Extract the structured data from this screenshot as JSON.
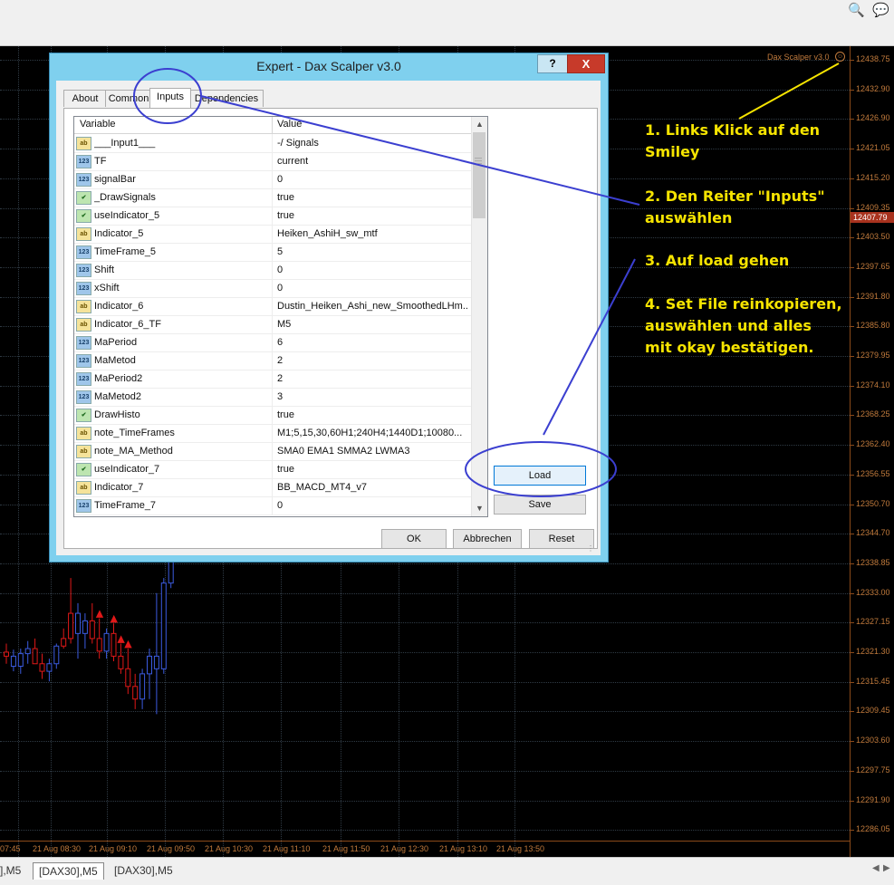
{
  "toolbar": {
    "icons": [
      "search-icon",
      "chat-bubbles-icon"
    ]
  },
  "chart": {
    "indicator_name": "Dax Scalper v3.0",
    "price_labels": [
      "12438.75",
      "12432.90",
      "12426.90",
      "12421.05",
      "12415.20",
      "12409.35",
      "12403.50",
      "12397.65",
      "12391.80",
      "12385.80",
      "12379.95",
      "12374.10",
      "12368.25",
      "12362.40",
      "12356.55",
      "12350.70",
      "12344.70",
      "12338.85",
      "12333.00",
      "12327.15",
      "12321.30",
      "12315.45",
      "12309.45",
      "12303.60",
      "12297.75",
      "12291.90",
      "12286.05"
    ],
    "current_price": "12407.79",
    "time_labels": [
      "07:45",
      "21 Aug 08:30",
      "21 Aug 09:10",
      "21 Aug 09:50",
      "21 Aug 10:30",
      "21 Aug 11:10",
      "21 Aug 11:50",
      "21 Aug 12:30",
      "21 Aug 13:10",
      "21 Aug 13:50"
    ],
    "candles": [
      {
        "o": 12321.3,
        "h": 12323.0,
        "l": 12319.0,
        "c": 12320.5,
        "dir": "down"
      },
      {
        "o": 12320.5,
        "h": 12321.8,
        "l": 12317.5,
        "c": 12318.5,
        "dir": "up"
      },
      {
        "o": 12318.5,
        "h": 12322.0,
        "l": 12317.0,
        "c": 12321.0,
        "dir": "up"
      },
      {
        "o": 12321.0,
        "h": 12323.5,
        "l": 12319.0,
        "c": 12322.0,
        "dir": "up"
      },
      {
        "o": 12322.0,
        "h": 12324.0,
        "l": 12320.0,
        "c": 12319.0,
        "dir": "down"
      },
      {
        "o": 12319.0,
        "h": 12321.0,
        "l": 12316.0,
        "c": 12317.5,
        "dir": "down"
      },
      {
        "o": 12317.5,
        "h": 12320.0,
        "l": 12315.5,
        "c": 12319.0,
        "dir": "up"
      },
      {
        "o": 12319.0,
        "h": 12323.0,
        "l": 12318.0,
        "c": 12322.5,
        "dir": "up"
      },
      {
        "o": 12322.5,
        "h": 12326.0,
        "l": 12322.0,
        "c": 12324.0,
        "dir": "down"
      },
      {
        "o": 12324.0,
        "h": 12336.0,
        "l": 12323.0,
        "c": 12329.0,
        "dir": "down"
      },
      {
        "o": 12329.0,
        "h": 12331.0,
        "l": 12320.0,
        "c": 12325.0,
        "dir": "up"
      },
      {
        "o": 12325.0,
        "h": 12329.0,
        "l": 12322.0,
        "c": 12327.5,
        "dir": "up"
      },
      {
        "o": 12327.5,
        "h": 12331.0,
        "l": 12323.0,
        "c": 12324.0,
        "dir": "down"
      },
      {
        "o": 12324.0,
        "h": 12328.0,
        "l": 12320.0,
        "c": 12321.5,
        "dir": "down"
      },
      {
        "o": 12321.5,
        "h": 12326.0,
        "l": 12320.0,
        "c": 12325.0,
        "dir": "up"
      },
      {
        "o": 12325.0,
        "h": 12327.0,
        "l": 12319.5,
        "c": 12320.5,
        "dir": "down"
      },
      {
        "o": 12320.5,
        "h": 12323.0,
        "l": 12317.0,
        "c": 12318.0,
        "dir": "down"
      },
      {
        "o": 12318.0,
        "h": 12322.0,
        "l": 12313.0,
        "c": 12314.5,
        "dir": "down"
      },
      {
        "o": 12314.5,
        "h": 12317.0,
        "l": 12310.0,
        "c": 12312.0,
        "dir": "down"
      },
      {
        "o": 12312.0,
        "h": 12318.0,
        "l": 12310.0,
        "c": 12317.0,
        "dir": "up"
      },
      {
        "o": 12317.0,
        "h": 12322.0,
        "l": 12312.0,
        "c": 12320.5,
        "dir": "up"
      },
      {
        "o": 12320.5,
        "h": 12333.0,
        "l": 12309.0,
        "c": 12318.0,
        "dir": "up"
      },
      {
        "o": 12318.0,
        "h": 12336.0,
        "l": 12317.0,
        "c": 12335.0,
        "dir": "up"
      },
      {
        "o": 12335.0,
        "h": 12342.0,
        "l": 12334.0,
        "c": 12340.0,
        "dir": "up"
      }
    ],
    "signals": [
      {
        "index": 13,
        "type": "sell"
      },
      {
        "index": 15,
        "type": "sell"
      },
      {
        "index": 16,
        "type": "sell"
      },
      {
        "index": 17,
        "type": "sell"
      }
    ]
  },
  "annotations": [
    "1. Links Klick auf den\nSmiley",
    "2. Den Reiter \"Inputs\"\nauswählen",
    "3. Auf load gehen",
    "4. Set File reinkopieren,\nauswählen und alles\nmit okay bestätigen."
  ],
  "dialog": {
    "title": "Expert - Dax Scalper v3.0",
    "help_label": "?",
    "close_label": "X",
    "tabs": [
      "About",
      "Common",
      "Inputs",
      "Dependencies"
    ],
    "selected_tab": "Inputs",
    "columns": {
      "variable": "Variable",
      "value": "Value"
    },
    "rows": [
      {
        "type": "ab",
        "variable": "___Input1___",
        "value": "-/ Signals"
      },
      {
        "type": "num",
        "variable": "TF",
        "value": "current"
      },
      {
        "type": "num",
        "variable": "signalBar",
        "value": "0"
      },
      {
        "type": "bool",
        "variable": "_DrawSignals",
        "value": "true"
      },
      {
        "type": "bool",
        "variable": "useIndicator_5",
        "value": "true"
      },
      {
        "type": "ab",
        "variable": "Indicator_5",
        "value": "Heiken_AshiH_sw_mtf"
      },
      {
        "type": "num",
        "variable": "TimeFrame_5",
        "value": "5"
      },
      {
        "type": "num",
        "variable": "Shift",
        "value": "0"
      },
      {
        "type": "num",
        "variable": "xShift",
        "value": "0"
      },
      {
        "type": "ab",
        "variable": "Indicator_6",
        "value": "Dustin_Heiken_Ashi_new_SmoothedLHm..."
      },
      {
        "type": "ab",
        "variable": "Indicator_6_TF",
        "value": "M5"
      },
      {
        "type": "num",
        "variable": "MaPeriod",
        "value": "6"
      },
      {
        "type": "num",
        "variable": "MaMetod",
        "value": "2"
      },
      {
        "type": "num",
        "variable": "MaPeriod2",
        "value": "2"
      },
      {
        "type": "num",
        "variable": "MaMetod2",
        "value": "3"
      },
      {
        "type": "bool",
        "variable": "DrawHisto",
        "value": "true"
      },
      {
        "type": "ab",
        "variable": "note_TimeFrames",
        "value": "M1;5,15,30,60H1;240H4;1440D1;10080..."
      },
      {
        "type": "ab",
        "variable": "note_MA_Method",
        "value": "SMA0 EMA1 SMMA2 LWMA3"
      },
      {
        "type": "bool",
        "variable": "useIndicator_7",
        "value": "true"
      },
      {
        "type": "ab",
        "variable": "Indicator_7",
        "value": "BB_MACD_MT4_v7"
      },
      {
        "type": "num",
        "variable": "TimeFrame_7",
        "value": "0"
      }
    ],
    "buttons": {
      "load": "Load",
      "save": "Save",
      "ok": "OK",
      "cancel": "Abbrechen",
      "reset": "Reset"
    }
  },
  "chart_tabs": [
    "],M5",
    "[DAX30],M5",
    "[DAX30],M5"
  ],
  "colors": {
    "annotation_text": "#f6e400",
    "highlight_circle": "#3b3fd0",
    "bear_candle": "#e01818",
    "bull_candle": "#3b5be0"
  }
}
